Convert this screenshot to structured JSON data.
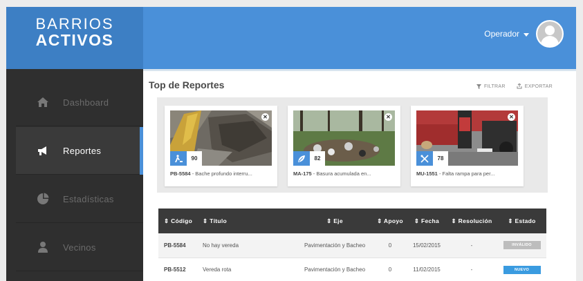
{
  "logo": {
    "line1": "BARRIOS",
    "line2": "ACTIVOS"
  },
  "user": {
    "name": "Operador"
  },
  "sidebar": {
    "items": [
      {
        "label": "Dashboard",
        "icon": "home-icon",
        "active": false
      },
      {
        "label": "Reportes",
        "icon": "megaphone-icon",
        "active": true
      },
      {
        "label": "Estadísticas",
        "icon": "pie-chart-icon",
        "active": false
      },
      {
        "label": "Vecinos",
        "icon": "person-icon",
        "active": false
      }
    ]
  },
  "section": {
    "title": "Top de Reportes",
    "filter_label": "FILTRAR",
    "export_label": "EXPORTAR"
  },
  "cards": [
    {
      "code": "PB-5584",
      "title": "Bache profundo interru...",
      "count": "90",
      "icon": "road-worker-icon"
    },
    {
      "code": "MA-175",
      "title": "Basura acumulada en...",
      "count": "82",
      "icon": "leaf-icon"
    },
    {
      "code": "MU-1551",
      "title": "Falta rampa para per...",
      "count": "78",
      "icon": "tools-icon"
    }
  ],
  "table": {
    "headers": [
      "Código",
      "Título",
      "Eje",
      "Apoyo",
      "Fecha",
      "Resolución",
      "Estado"
    ],
    "rows": [
      {
        "code": "PB-5584",
        "title": "No hay vereda",
        "axis": "Pavimentación y Bacheo",
        "support": "0",
        "date": "15/02/2015",
        "resolution": "-",
        "status": "INVÁLIDO",
        "status_color": "#bdbdbd"
      },
      {
        "code": "PB-5512",
        "title": "Vereda rota",
        "axis": "Pavimentación y Bacheo",
        "support": "0",
        "date": "11/02/2015",
        "resolution": "-",
        "status": "NUEVO",
        "status_color": "#3a9be0"
      }
    ]
  },
  "colors": {
    "accent": "#4a90d9",
    "sidebar": "#2f2f2f",
    "table_header": "#3a3a3a"
  }
}
